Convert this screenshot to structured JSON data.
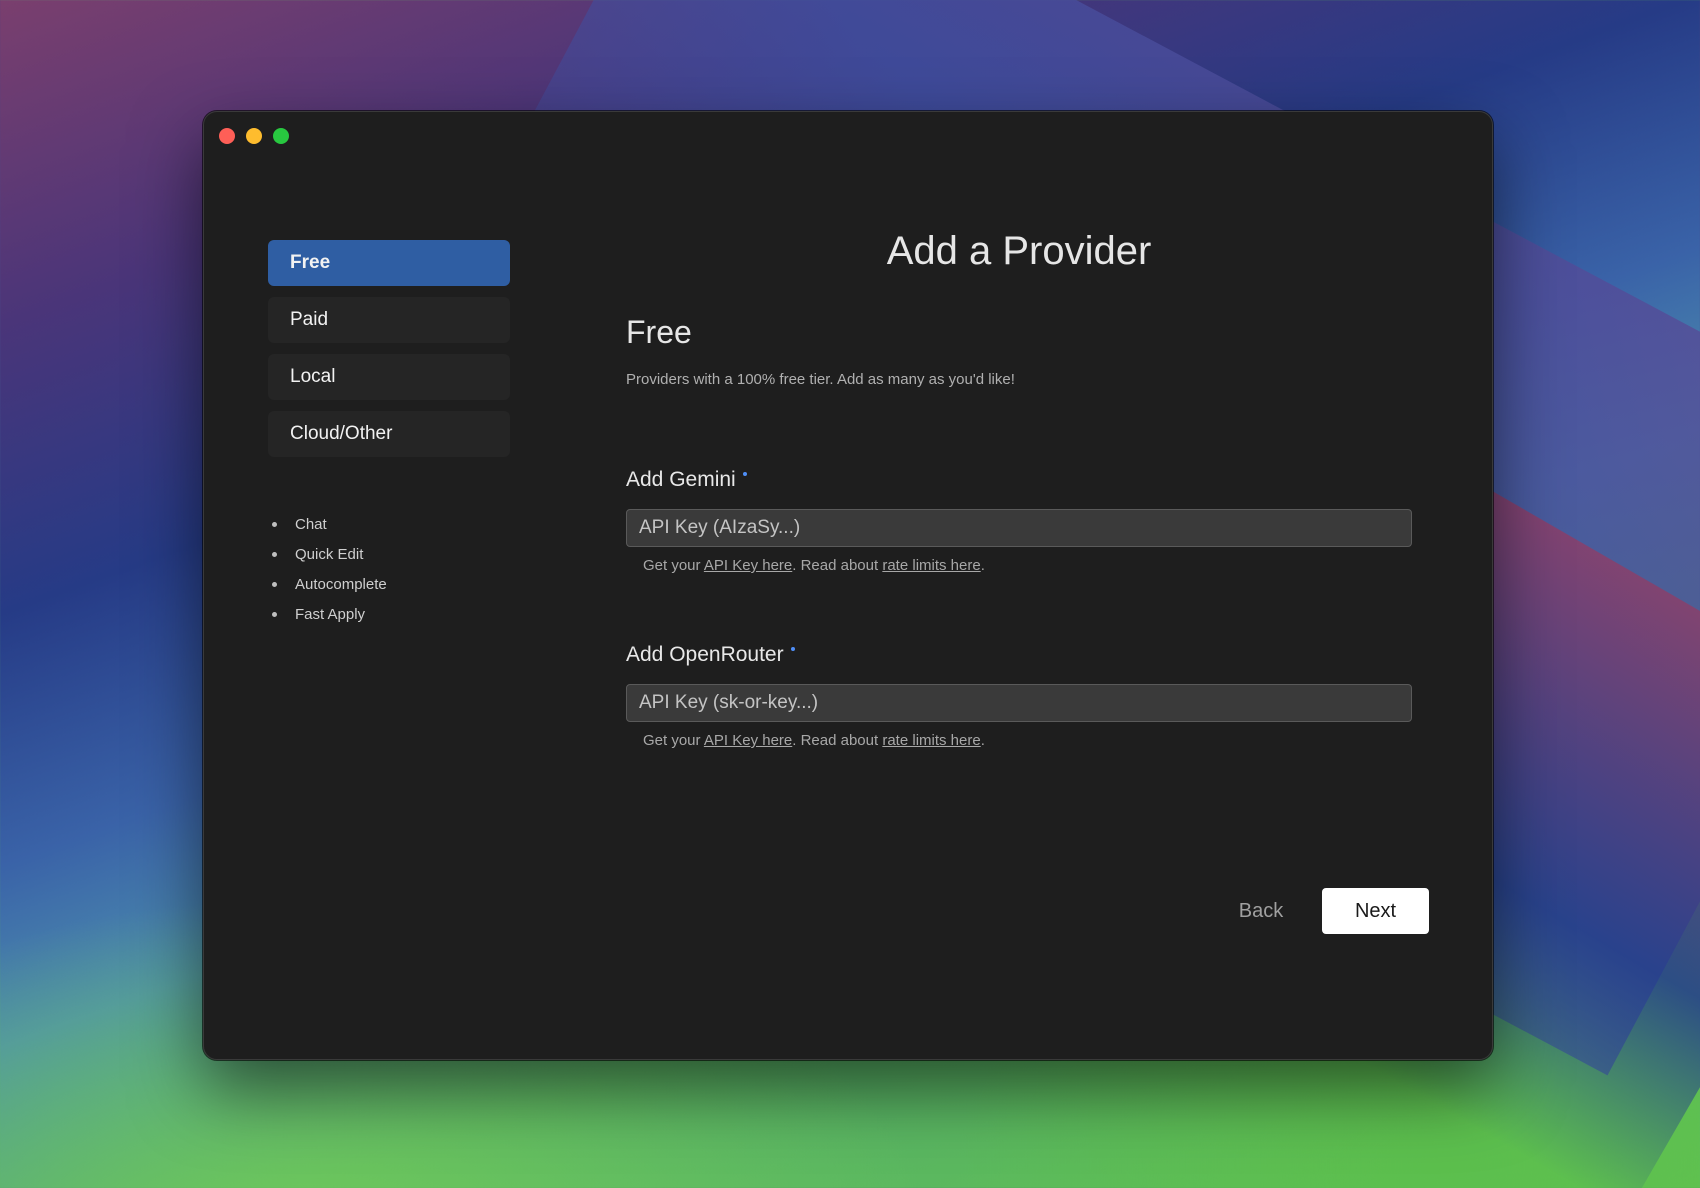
{
  "sidebar": {
    "tabs": [
      {
        "label": "Free",
        "active": true
      },
      {
        "label": "Paid",
        "active": false
      },
      {
        "label": "Local",
        "active": false
      },
      {
        "label": "Cloud/Other",
        "active": false
      }
    ],
    "features": [
      "Chat",
      "Quick Edit",
      "Autocomplete",
      "Fast Apply"
    ]
  },
  "main": {
    "title": "Add a Provider",
    "section_title": "Free",
    "section_desc": "Providers with a 100% free tier. Add as many as you'd like!",
    "providers": [
      {
        "title": "Add Gemini",
        "placeholder": "API Key (AIzaSy...)",
        "help_prefix": "Get your ",
        "help_link1": "API Key here",
        "help_middle": ". Read about ",
        "help_link2": "rate limits here",
        "help_suffix": "."
      },
      {
        "title": "Add OpenRouter",
        "placeholder": "API Key (sk-or-key...)",
        "help_prefix": "Get your ",
        "help_link1": "API Key here",
        "help_middle": ". Read about ",
        "help_link2": "rate limits here",
        "help_suffix": "."
      }
    ]
  },
  "footer": {
    "back_label": "Back",
    "next_label": "Next"
  },
  "colors": {
    "accent": "#2f5ea3",
    "required_dot": "#4f8ef7",
    "window_bg": "#1e1e1e"
  }
}
